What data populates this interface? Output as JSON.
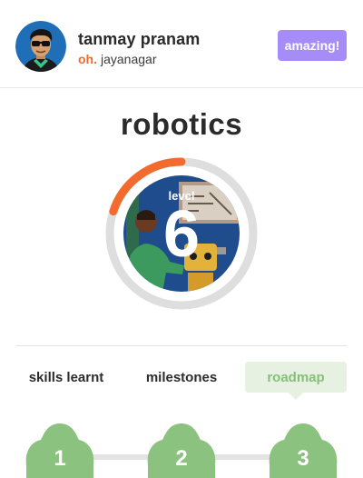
{
  "header": {
    "user_name": "tanmay pranam",
    "location_prefix": "oh.",
    "location": "jayanagar",
    "badge_label": "amazing!"
  },
  "course": {
    "title": "robotics",
    "level_word": "level",
    "level_number": "6",
    "progress_fraction": 0.2
  },
  "tabs": [
    {
      "label": "skills learnt",
      "active": false
    },
    {
      "label": "milestones",
      "active": false
    },
    {
      "label": "roadmap",
      "active": true
    }
  ],
  "roadmap": {
    "steps": [
      "1",
      "2",
      "3"
    ]
  },
  "colors": {
    "accent_purple": "#a58cf7",
    "progress_orange": "#f26a2e",
    "ring_gray": "#dedede",
    "step_green": "#8cc27f",
    "tab_active_bg": "#e6f1e2",
    "tab_active_text": "#86bf79"
  },
  "icons": {
    "avatar": "avatar-cartoon-man-sunglasses",
    "level_art": "robotics-illustration"
  }
}
